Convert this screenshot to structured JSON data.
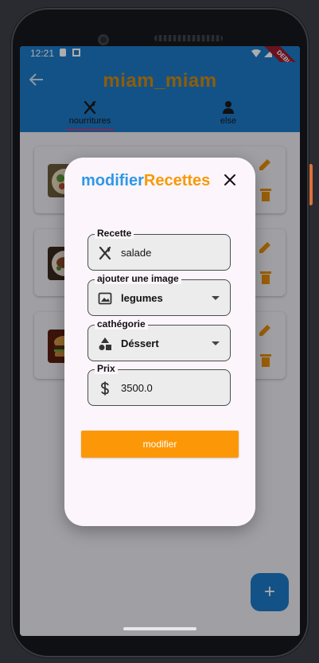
{
  "status_bar": {
    "time": "12:21",
    "debug_label": "DEBUG"
  },
  "app_bar": {
    "title": "miam_miam",
    "tabs": [
      {
        "label": "nourritures",
        "icon": "fork-knife-icon",
        "selected": true
      },
      {
        "label": "else",
        "icon": "person-icon",
        "selected": false
      }
    ]
  },
  "colors": {
    "primary": "#1d7ac7",
    "accent_orange": "#f69a06",
    "title_blue": "#2e98e6",
    "title_gold": "#d08a10",
    "icon_orange": "#e38d0c",
    "tab_indicator": "#c03e6e"
  },
  "recipe_cards": [
    {
      "thumbnail": "salad-image"
    },
    {
      "thumbnail": "meat-image"
    },
    {
      "thumbnail": "burger-image"
    }
  ],
  "fab": {
    "icon": "plus-icon"
  },
  "dialog": {
    "title_part1": "modifier",
    "title_part2": "Recettes",
    "close_icon": "close-icon",
    "fields": {
      "recette": {
        "label": "Recette",
        "value": "salade",
        "icon": "fork-knife-icon"
      },
      "image": {
        "label": "ajouter une image",
        "value": "legumes",
        "icon": "image-icon"
      },
      "categorie": {
        "label": "cathégorie",
        "value": "Déssert",
        "icon": "shapes-icon"
      },
      "prix": {
        "label": "Prix",
        "value": "3500.0",
        "icon": "dollar-icon"
      }
    },
    "submit_label": "modifier"
  }
}
